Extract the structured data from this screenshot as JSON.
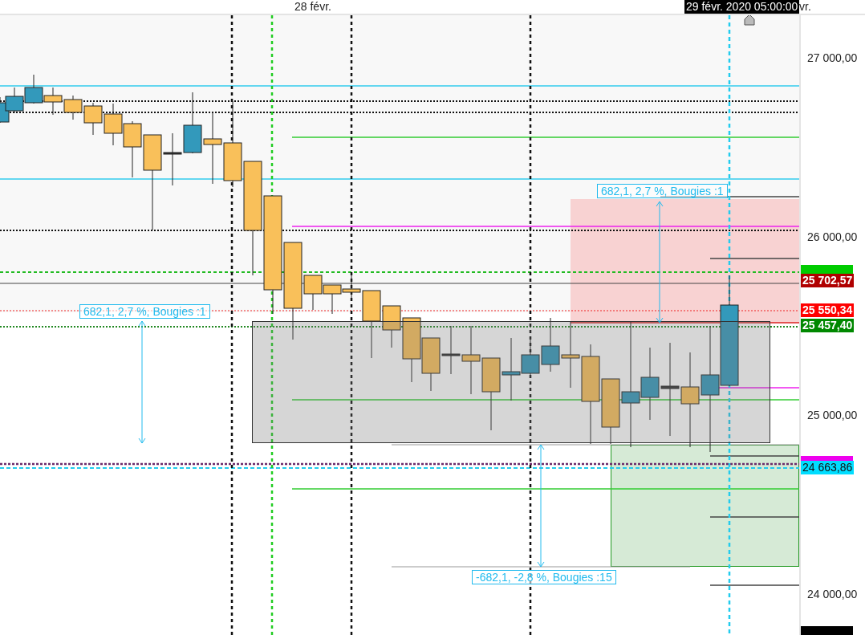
{
  "time_axis": {
    "labels": [
      {
        "text": "28 févr.",
        "kind": "plain"
      },
      {
        "text": "29 févr. 2020 05:00:00",
        "kind": "cursor"
      },
      {
        "text": "vr.",
        "kind": "plain"
      }
    ]
  },
  "price_axis": {
    "ticks": [
      "27 000,00",
      "26 000,00",
      "25 000,00",
      "24 000,00"
    ],
    "tags": [
      {
        "kind": "marker",
        "color": "#00cc00"
      },
      {
        "kind": "label",
        "text": "25 702,57",
        "color": "#b00000"
      },
      {
        "kind": "label",
        "text": "25 550,34",
        "color": "#ff0000"
      },
      {
        "kind": "label",
        "text": "25 457,40",
        "color": "#008800"
      },
      {
        "kind": "marker",
        "color": "#ee00ee"
      },
      {
        "kind": "label",
        "text": "24 663,86",
        "color": "#00ddff"
      },
      {
        "kind": "marker",
        "color": "#000000"
      }
    ]
  },
  "measurements": [
    {
      "text": "682,1, 2,7 %, Bougies :1"
    },
    {
      "text": "682,1, 2,7 %, Bougies :1"
    },
    {
      "text": "-682,1, -2,8 %, Bougies :15"
    }
  ]
}
